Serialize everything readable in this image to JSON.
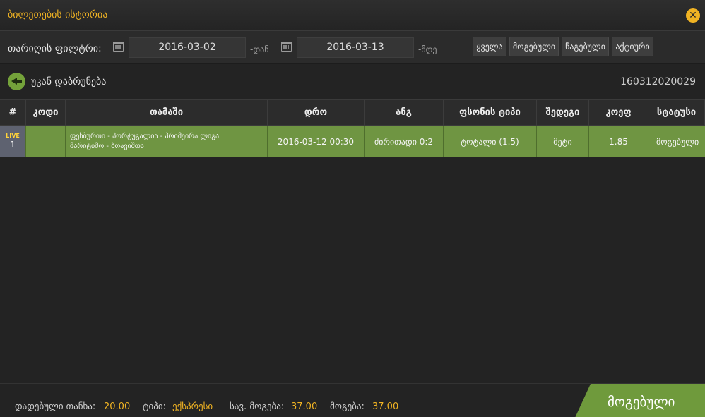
{
  "window": {
    "title": "ბილეთების ისტორია",
    "close_glyph": "✕"
  },
  "filter": {
    "label": "თარიღის ფილტრი:",
    "from_date": "2016-03-02",
    "from_suffix": "-დან",
    "to_date": "2016-03-13",
    "to_suffix": "-მდე",
    "buttons": [
      "ყველა",
      "მოგებული",
      "წაგებული",
      "აქტიური"
    ]
  },
  "back": {
    "label": "უკან დაბრუნება",
    "ticket_id": "160312020029"
  },
  "table": {
    "headers": [
      "#",
      "კოდი",
      "თამაში",
      "დრო",
      "ანგ",
      "ფსონის ტიპი",
      "შედეგი",
      "კოეფ",
      "სტატუსი"
    ],
    "rows": [
      {
        "live": "LIVE",
        "num": "1",
        "code": "",
        "game_line1": "ფეხბურთი - პორტუგალია - პრიმეირა ლიგა",
        "game_line2": "მარიტიმო - ბოავიშთა",
        "time": "2016-03-12 00:30",
        "score": "ძირითადი 0:2",
        "bet_type": "ტოტალი (1.5)",
        "result": "მეტი",
        "odds": "1.85",
        "status": "მოგებული"
      }
    ]
  },
  "footer": {
    "stake_label": "დადებული თანხა:",
    "stake_value": "20.00",
    "type_label": "ტიპი:",
    "type_value": "ექსპრესი",
    "potential_label": "სავ. მოგება:",
    "potential_value": "37.00",
    "win_label": "მოგება:",
    "win_value": "37.00",
    "status": "მოგებული"
  },
  "colors": {
    "accent": "#f0b323",
    "win_green": "#6f9542",
    "background": "#232323"
  }
}
